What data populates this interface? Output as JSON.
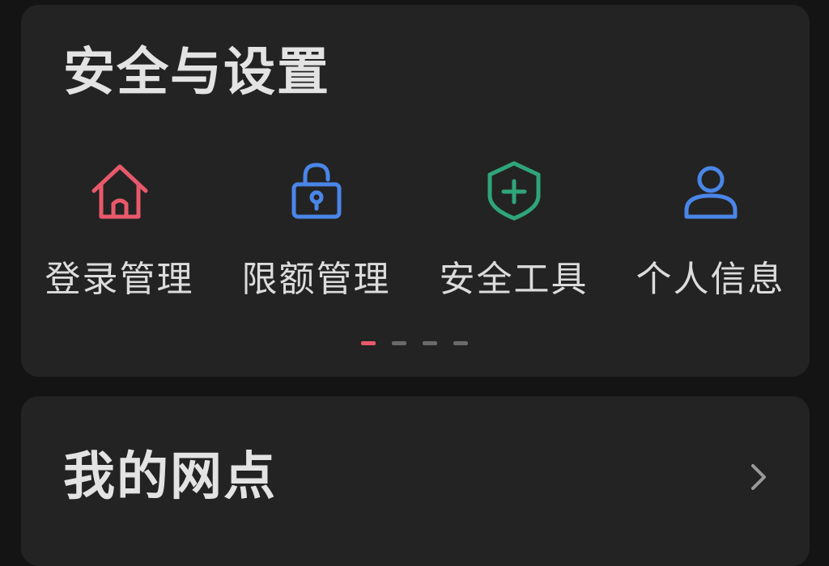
{
  "security": {
    "title": "安全与设置",
    "items": [
      {
        "label": "登录管理",
        "icon": "home-icon",
        "color": "#e8596b"
      },
      {
        "label": "限额管理",
        "icon": "lock-icon",
        "color": "#4a86e8"
      },
      {
        "label": "安全工具",
        "icon": "shield-plus-icon",
        "color": "#2fa57a"
      },
      {
        "label": "个人信息",
        "icon": "user-icon",
        "color": "#4a86e8"
      }
    ],
    "pager": {
      "count": 4,
      "active_index": 0,
      "active_color": "#e8596b",
      "inactive_color": "#6a6a6a"
    }
  },
  "outlets": {
    "title": "我的网点",
    "chevron_icon": "chevron-right-icon"
  }
}
